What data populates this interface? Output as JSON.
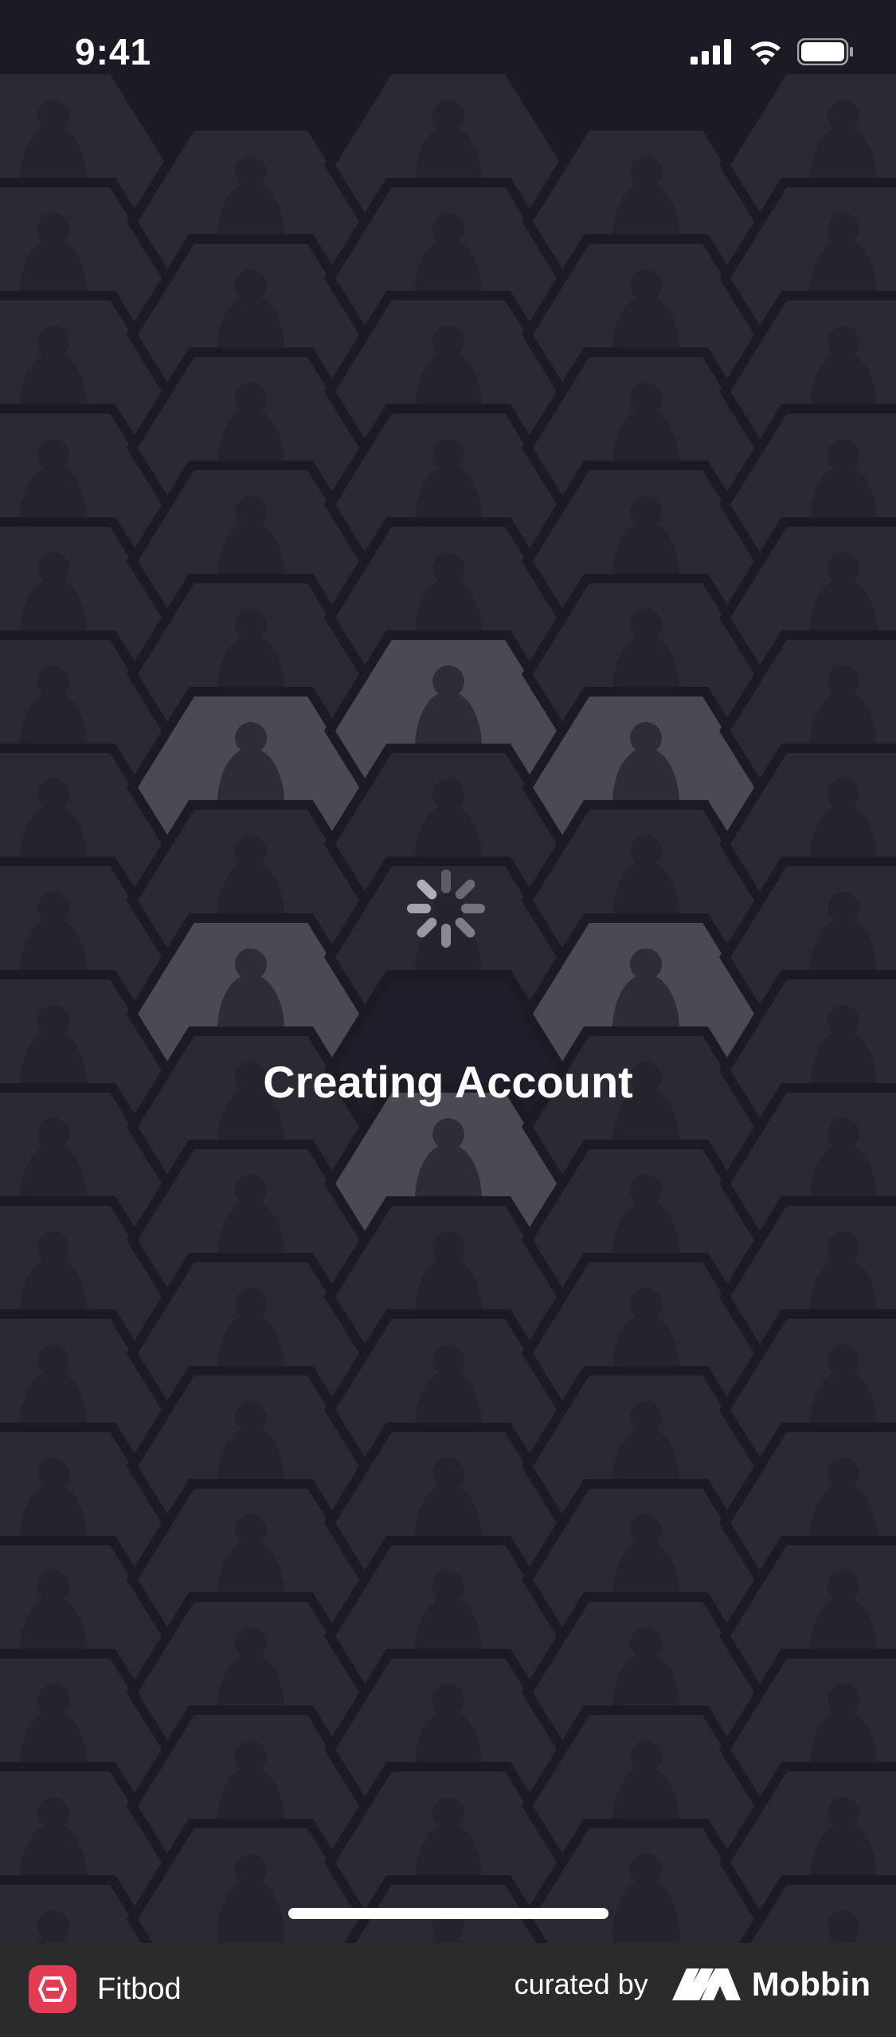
{
  "status_bar": {
    "time": "9:41",
    "icons": [
      "cellular-signal-icon",
      "wifi-icon",
      "battery-icon"
    ]
  },
  "loading": {
    "message": "Creating Account",
    "spinner_icon": "spinner-icon"
  },
  "background": {
    "description_icon": "exercise-photo-hexagon-grid"
  },
  "footer": {
    "app_name": "Fitbod",
    "app_logo_icon": "fitbod-logo-icon",
    "curated_label": "curated by",
    "source_name": "Mobbin",
    "source_logo_icon": "mobbin-logo-icon"
  },
  "colors": {
    "background": "#1b1b26",
    "footer": "#2b2b2b",
    "brand_red": "#e43b55",
    "text": "#ffffff"
  }
}
